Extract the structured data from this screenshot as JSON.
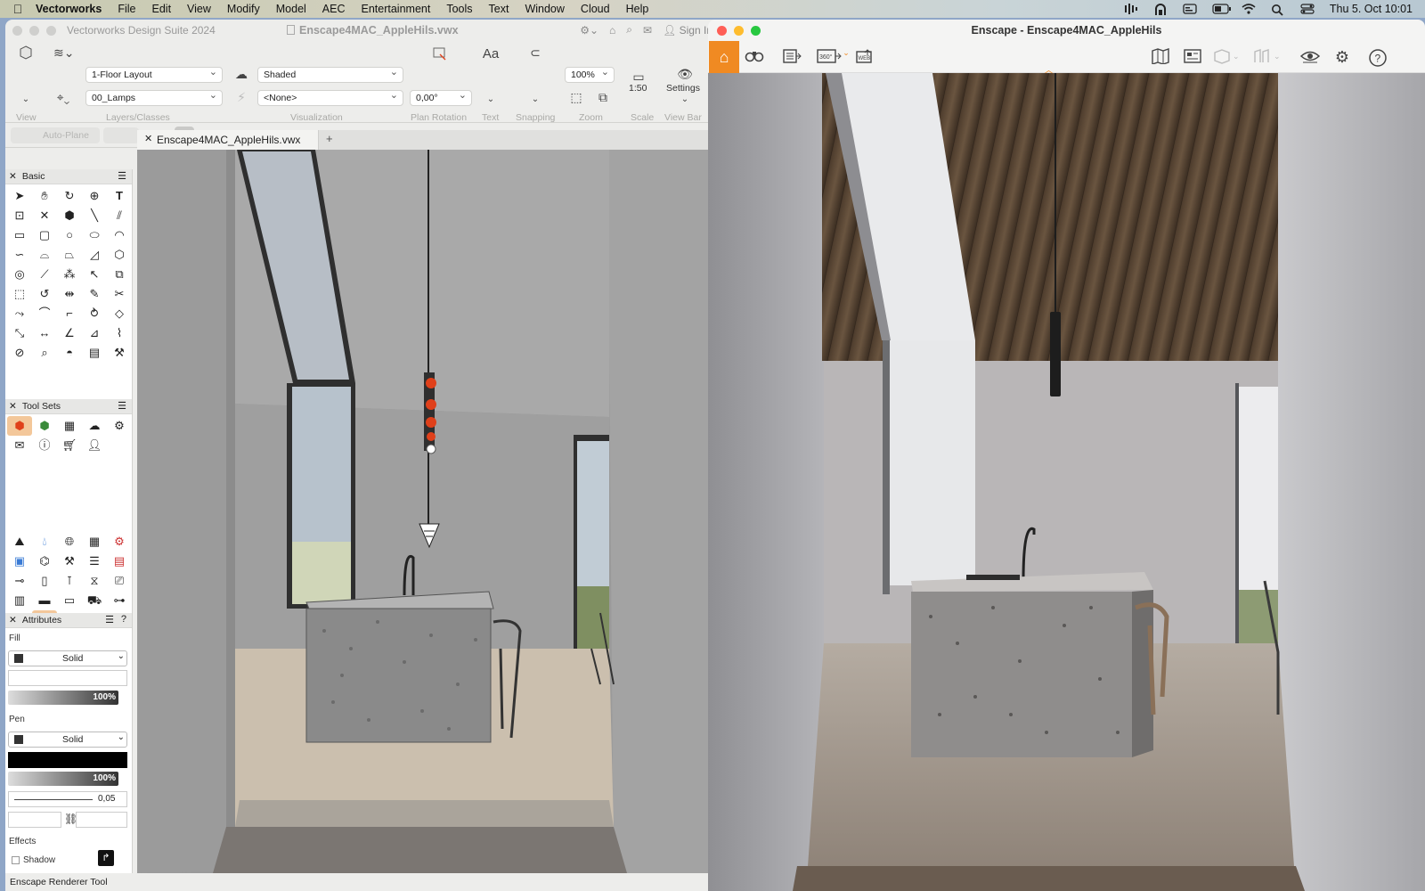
{
  "menubar": {
    "app": "Vectorworks",
    "menus": [
      "File",
      "Edit",
      "View",
      "Modify",
      "Model",
      "AEC",
      "Entertainment",
      "Tools",
      "Text",
      "Window",
      "Cloud",
      "Help"
    ],
    "clock": "Thu 5. Oct  10:01"
  },
  "vectorworks": {
    "app_title": "Vectorworks Design Suite 2024",
    "doc_title": "Enscape4MAC_AppleHils.vwx",
    "sign_in": "Sign In",
    "toolbar": {
      "view_label": "View",
      "layer_value": "1-Floor Layout",
      "class_value": "00_Lamps",
      "layers_classes_label": "Layers/Classes",
      "render_mode": "Shaded",
      "second_mode": "<None>",
      "visualization_label": "Visualization",
      "rotation_value": "0,00°",
      "plan_rotation_label": "Plan Rotation",
      "text_icon": "Aa",
      "text_label": "Text",
      "snapping_label": "Snapping",
      "zoom_value": "100%",
      "zoom_label": "Zoom",
      "scale_value": "1:50",
      "scale_label": "Scale",
      "settings_label": "Settings",
      "view_bar_label": "View Bar"
    },
    "modebar": {
      "auto_plane": "Auto-Plane"
    },
    "palettes": {
      "basic": "Basic",
      "tool_sets": "Tool Sets",
      "attributes": "Attributes"
    },
    "attributes": {
      "fill_label": "Fill",
      "fill_style": "Solid",
      "fill_opacity": "100%",
      "pen_label": "Pen",
      "pen_style": "Solid",
      "pen_opacity": "100%",
      "line_weight": "0,05",
      "effects_label": "Effects",
      "shadow_label": "Shadow"
    },
    "tab": "Enscape4MAC_AppleHils.vwx",
    "status": "Enscape Renderer Tool"
  },
  "enscape": {
    "title": "Enscape - Enscape4MAC_AppleHils",
    "icons": [
      "home-icon",
      "binoculars-icon",
      "batch-render-icon",
      "panorama-360-icon",
      "web-export-icon",
      "map-icon",
      "render-settings-icon",
      "cube-icon",
      "asset-library-icon",
      "visual-settings-icon",
      "gear-icon",
      "help-icon"
    ],
    "panorama_label": "360°",
    "web_label": "WEB",
    "help": "?"
  },
  "colors": {
    "accent_orange": "#f08a22",
    "selection_red": "#e0401a"
  }
}
